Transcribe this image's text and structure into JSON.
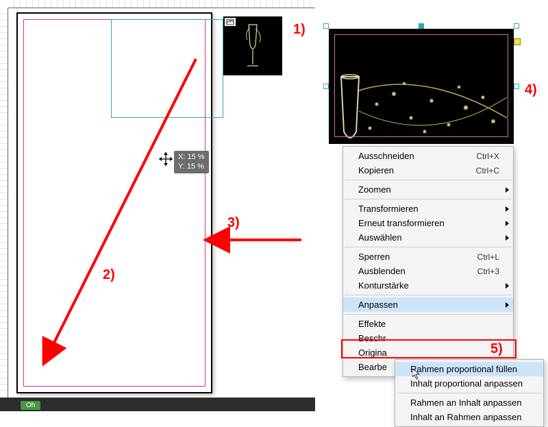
{
  "coord_tip": {
    "x": "X: 15 %",
    "y": "Y: 15 %"
  },
  "status": {
    "label": "Oh"
  },
  "annotations": {
    "n1": "1)",
    "n2": "2)",
    "n3": "3)",
    "n4": "4)",
    "n5": "5)"
  },
  "context_menu": {
    "cut": {
      "label": "Ausschneiden",
      "shortcut": "Ctrl+X"
    },
    "copy": {
      "label": "Kopieren",
      "shortcut": "Ctrl+C"
    },
    "zoom": {
      "label": "Zoomen"
    },
    "transform": {
      "label": "Transformieren"
    },
    "retransform": {
      "label": "Erneut transformieren"
    },
    "select": {
      "label": "Auswählen"
    },
    "lock": {
      "label": "Sperren",
      "shortcut": "Ctrl+L"
    },
    "hide": {
      "label": "Ausblenden",
      "shortcut": "Ctrl+3"
    },
    "stroke": {
      "label": "Konturstärke"
    },
    "fit": {
      "label": "Anpassen"
    },
    "effects": {
      "label": "Effekte"
    },
    "caption": {
      "label": "Beschr"
    },
    "original": {
      "label": "Origina"
    },
    "edit": {
      "label": "Bearbe"
    }
  },
  "submenu": {
    "fill_prop": {
      "label": "Rahmen proportional füllen"
    },
    "fit_cont_prop": {
      "label": "Inhalt proportional anpassen"
    },
    "frame_to_cont": {
      "label": "Rahmen an Inhalt anpassen"
    },
    "cont_to_frame": {
      "label": "Inhalt an Rahmen anpassen"
    }
  }
}
